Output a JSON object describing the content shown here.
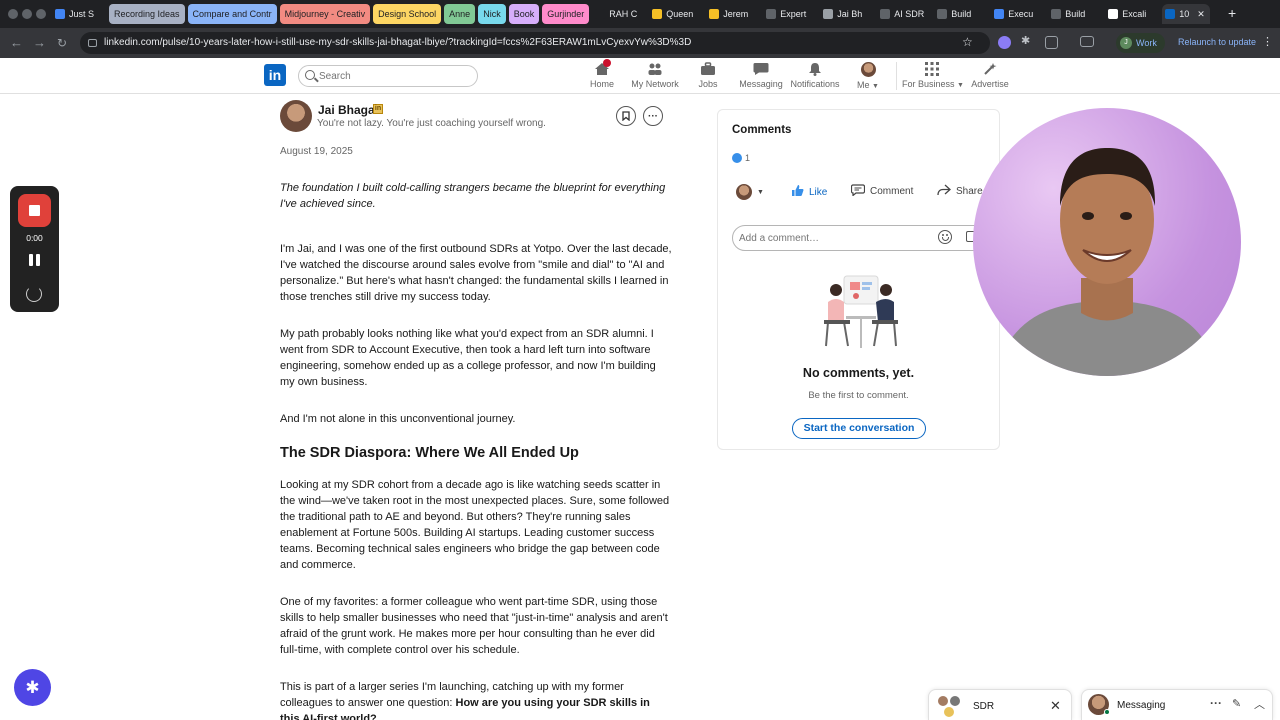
{
  "browser": {
    "tabs": [
      {
        "label": "Just S",
        "kind": "plain",
        "fav": "#4285f4"
      },
      {
        "label": "Recording Ideas",
        "kind": "grp",
        "color": "#a8b1c4"
      },
      {
        "label": "Compare and Contr",
        "kind": "grp",
        "color": "#8ab4f8"
      },
      {
        "label": "Midjourney - Creativ",
        "kind": "grp",
        "color": "#f28b82"
      },
      {
        "label": "Design School",
        "kind": "grp",
        "color": "#fdd663"
      },
      {
        "label": "Anne",
        "kind": "grp",
        "color": "#81c995"
      },
      {
        "label": "Nick",
        "kind": "grp",
        "color": "#78d9ec"
      },
      {
        "label": "Book",
        "kind": "grp",
        "color": "#d7aefb"
      },
      {
        "label": "Gurjinder",
        "kind": "grp",
        "color": "#ff8bcb"
      },
      {
        "label": "RAH C",
        "kind": "plain",
        "fav": "#202124"
      },
      {
        "label": "Queen",
        "kind": "plain",
        "fav": "#f6c026"
      },
      {
        "label": "Jerem",
        "kind": "plain",
        "fav": "#f6c026"
      },
      {
        "label": "Expert",
        "kind": "plain",
        "fav": "#5f6368"
      },
      {
        "label": "Jai Bh",
        "kind": "plain",
        "fav": "#9aa0a6"
      },
      {
        "label": "AI SDR",
        "kind": "plain",
        "fav": "#5f6368"
      },
      {
        "label": "Build",
        "kind": "plain",
        "fav": "#5f6368"
      },
      {
        "label": "Execu",
        "kind": "plain",
        "fav": "#4285f4"
      },
      {
        "label": "Build",
        "kind": "plain",
        "fav": "#5f6368"
      },
      {
        "label": "Excali",
        "kind": "plain",
        "fav": "#ffffff"
      },
      {
        "label": "10",
        "kind": "active",
        "fav": "#0a66c2"
      }
    ],
    "url": "linkedin.com/pulse/10-years-later-how-i-still-use-my-sdr-skills-jai-bhagat-lbiye/?trackingId=fccs%2F63ERAW1mLvCyexvYw%3D%3D",
    "profile_label": "Work",
    "profile_initial": "J",
    "relaunch_label": "Relaunch to update"
  },
  "linkedin_nav": {
    "logo": "in",
    "search_placeholder": "Search",
    "items": [
      {
        "label": "Home"
      },
      {
        "label": "My Network"
      },
      {
        "label": "Jobs"
      },
      {
        "label": "Messaging"
      },
      {
        "label": "Notifications"
      },
      {
        "label": "Me"
      },
      {
        "label": "For Business"
      },
      {
        "label": "Advertise"
      }
    ]
  },
  "article": {
    "author_name": "Jai Bhagat",
    "author_badge": "in",
    "author_tagline": "You're not lazy. You're just coaching yourself wrong.",
    "date": "August 19, 2025",
    "intro": "The foundation I built cold-calling strangers became the blueprint for everything I've achieved since.",
    "p1": "I'm Jai, and I was one of the first outbound SDRs at Yotpo. Over the last decade, I've watched the discourse around sales evolve from \"smile and dial\" to \"AI and personalize.\" But here's what hasn't changed: the fundamental skills I learned in those trenches still drive my success today.",
    "p2": "My path probably looks nothing like what you'd expect from an SDR alumni. I went from SDR to Account Executive, then took a hard left turn into software engineering, somehow ended up as a college professor, and now I'm building my own business.",
    "p3": "And I'm not alone in this unconventional journey.",
    "heading": "The SDR Diaspora: Where We All Ended Up",
    "p4": "Looking at my SDR cohort from a decade ago is like watching seeds scatter in the wind—we've taken root in the most unexpected places. Sure, some followed the traditional path to AE and beyond. But others? They're running sales enablement at Fortune 500s. Building AI startups. Leading customer success teams. Becoming technical sales engineers who bridge the gap between code and commerce.",
    "p5": "One of my favorites: a former colleague who went part-time SDR, using those skills to help smaller businesses who need that \"just-in-time\" analysis and aren't afraid of the grunt work. He makes more per hour consulting than he ever did full-time, with complete control over his schedule.",
    "p6_lead": "This is part of a larger series I'm launching, catching up with my former colleagues to answer one question: ",
    "p6_bold": "How are you using your SDR skills in this AI-first world?"
  },
  "comments": {
    "title": "Comments",
    "reaction_count": "1",
    "like_label": "Like",
    "comment_label": "Comment",
    "share_label": "Share",
    "input_placeholder": "Add a comment…",
    "empty_title": "No comments, yet.",
    "empty_sub": "Be the first to comment.",
    "start_button": "Start the conversation"
  },
  "recorder": {
    "time": "0:00"
  },
  "messaging": {
    "sdr_label": "SDR",
    "messaging_label": "Messaging"
  },
  "colors": {
    "linkedin_blue": "#0a66c2",
    "record_red": "#e0413a",
    "webcam_bg": "#c592df"
  }
}
